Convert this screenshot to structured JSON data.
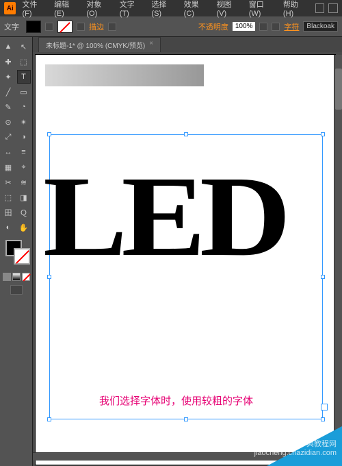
{
  "app": {
    "logo": "Ai"
  },
  "menu": {
    "items": [
      "文件(F)",
      "编辑(E)",
      "对象(O)",
      "文字(T)",
      "选择(S)",
      "效果(C)",
      "视图(V)",
      "窗口(W)",
      "帮助(H)"
    ]
  },
  "options": {
    "tool_label": "文字",
    "stroke_label": "描边",
    "opacity_label": "不透明度",
    "opacity_value": "100%",
    "char_panel": "字符",
    "font_name": "Blackoak"
  },
  "tools": {
    "list": [
      "▲",
      "↖",
      "✚",
      "⬚",
      "✦",
      "T",
      "╱",
      "▭",
      "✎",
      "◔",
      "⊙",
      "✴",
      "⤢",
      "◑",
      "↔",
      "≡",
      "▦",
      "⌖",
      "✂",
      "≋",
      "⬚",
      "◨",
      "田",
      "Ｑ",
      "◐",
      "✋"
    ]
  },
  "document": {
    "tab_title": "未标题-1* @ 100% (CMYK/预览)",
    "tab_close": "×"
  },
  "canvas": {
    "main_text": "LED",
    "note": "我们选择字体时，使用较粗的字体"
  },
  "watermark": {
    "line1": "查字典教程网",
    "line2": "jiaocheng.chazidian.com"
  }
}
